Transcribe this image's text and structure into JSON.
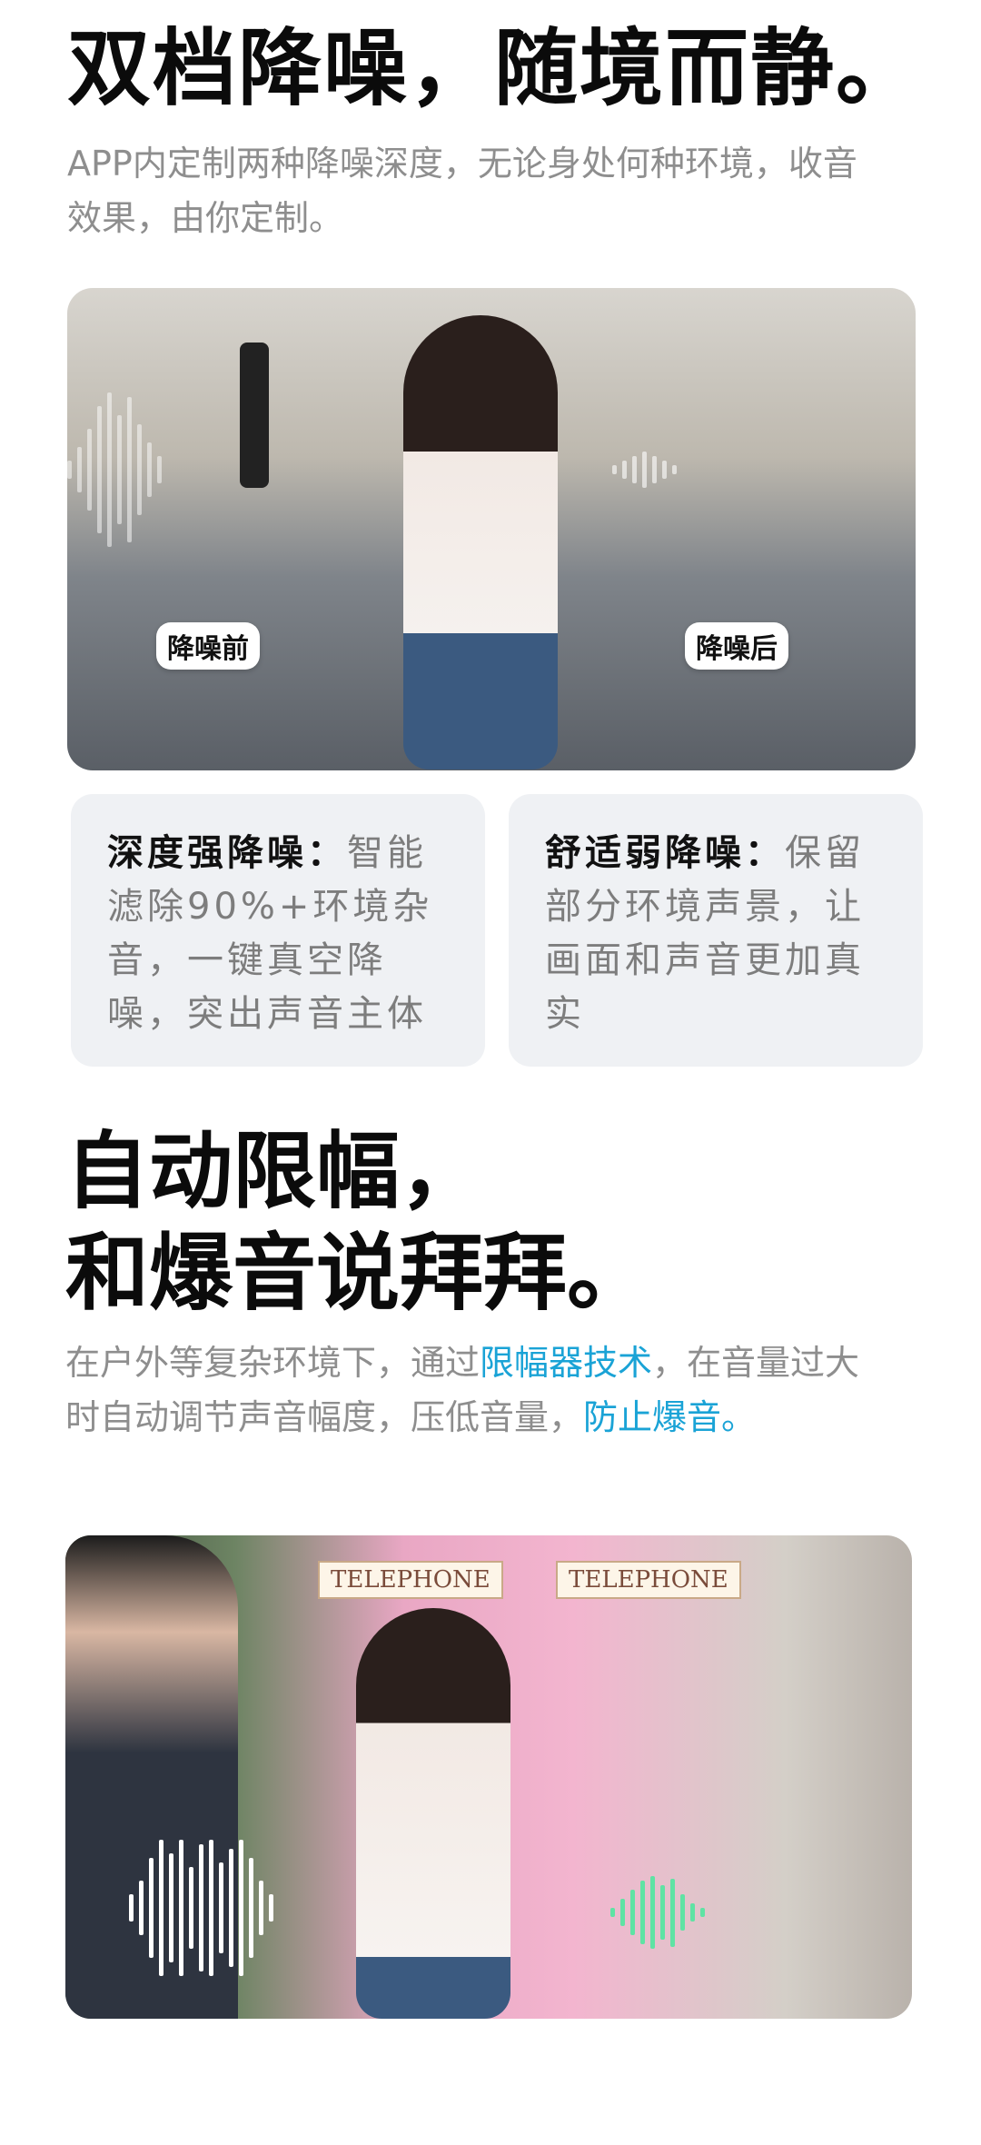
{
  "section1": {
    "title": "双档降噪，随境而静。",
    "description": "APP内定制两种降噪深度，无论身处何种环境，收音效果，由你定制。",
    "image_labels": {
      "before": "降噪前",
      "after": "降噪后"
    },
    "cards": [
      {
        "label": "深度强降噪：",
        "text": "智能滤除90%+环境杂音，一键真空降噪，突出声音主体"
      },
      {
        "label": "舒适弱降噪：",
        "text": "保留部分环境声景，让画面和声音更加真实"
      }
    ]
  },
  "section2": {
    "title_line1": "自动限幅，",
    "title_line2": "和爆音说拜拜。",
    "description_part1": "在户外等复杂环境下，通过",
    "description_highlight1": "限幅器技术",
    "description_part2": "，在音量过大时自动调节声音幅度，压低音量，",
    "description_highlight2": "防止爆音。",
    "image_labels": {
      "booth_left": "TELEPHONE",
      "booth_right": "TELEPHONE"
    }
  },
  "colors": {
    "accent_blue": "#1aa3d6",
    "card_bg": "#eff1f4",
    "wave_green": "#5fe3a4"
  }
}
